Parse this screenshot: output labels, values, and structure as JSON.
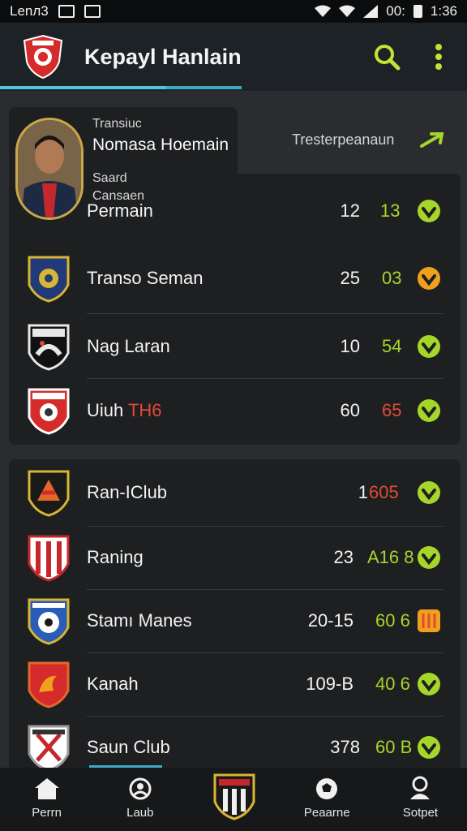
{
  "status_bar": {
    "left_text": "Lenл3",
    "right_text": "00:",
    "time": "1:36"
  },
  "app": {
    "title": "Kepayl Hanlain"
  },
  "profile": {
    "line1": "Transiuc",
    "name": "Nomasa Hoemain",
    "line3": "Saard",
    "line4": "Cansaen",
    "line5": "Permain",
    "trester": "Tresterpeanaun"
  },
  "card1_rows": [
    {
      "name": "",
      "v1": "12",
      "v2": "13",
      "v2_color": "#a6d629",
      "status": "down",
      "status_color": "#a6d629"
    },
    {
      "name": "Transo Seman",
      "v1": "25",
      "v2": "03",
      "v2_color": "#a6d629",
      "status": "down",
      "status_color": "#f0a01e"
    },
    {
      "name": "Nag Laran",
      "v1": "10",
      "v2": "54",
      "v2_color": "#a6d629",
      "status": "down",
      "status_color": "#a6d629"
    },
    {
      "name": "Uiuh",
      "name_highlight": "TH6",
      "v1": "60",
      "v2": "65",
      "v2_color": "#e24a34",
      "status": "down",
      "status_color": "#a6d629"
    }
  ],
  "card2_rows": [
    {
      "name": "Ran-IClub",
      "v1": "1",
      "v2": "605",
      "v2_color": "#e24a34",
      "status": "down",
      "status_color": "#a6d629"
    },
    {
      "name": "Raning",
      "v1": "23",
      "v2": "A16 8",
      "v2_color": "#a6d629",
      "status": "down",
      "status_color": "#a6d629"
    },
    {
      "name": "Stamı Manes",
      "v1": "20-15",
      "v2": "60 6",
      "v2_color": "#a6d629",
      "status": "mixed",
      "status_color": "#f0a01e"
    },
    {
      "name": "Kanah",
      "v1": "109-B",
      "v2": "40 6",
      "v2_color": "#a6d629",
      "status": "down",
      "status_color": "#a6d629"
    },
    {
      "name": "Saun Club",
      "v1": "378",
      "v2": "60 B",
      "v2_color": "#a6d629",
      "status": "down",
      "status_color": "#a6d629"
    }
  ],
  "nav": [
    {
      "label": "Perrn",
      "icon": "home-icon"
    },
    {
      "label": "Laub",
      "icon": "clock-user-icon"
    },
    {
      "label": "",
      "icon": "club-badge-icon"
    },
    {
      "label": "Peaarne",
      "icon": "soccer-ball-icon"
    },
    {
      "label": "Sotpet",
      "icon": "person-icon"
    }
  ],
  "colors": {
    "accent": "#3ea8c6",
    "positive": "#a6d629",
    "negative": "#e24a34",
    "warning": "#f0a01e"
  }
}
